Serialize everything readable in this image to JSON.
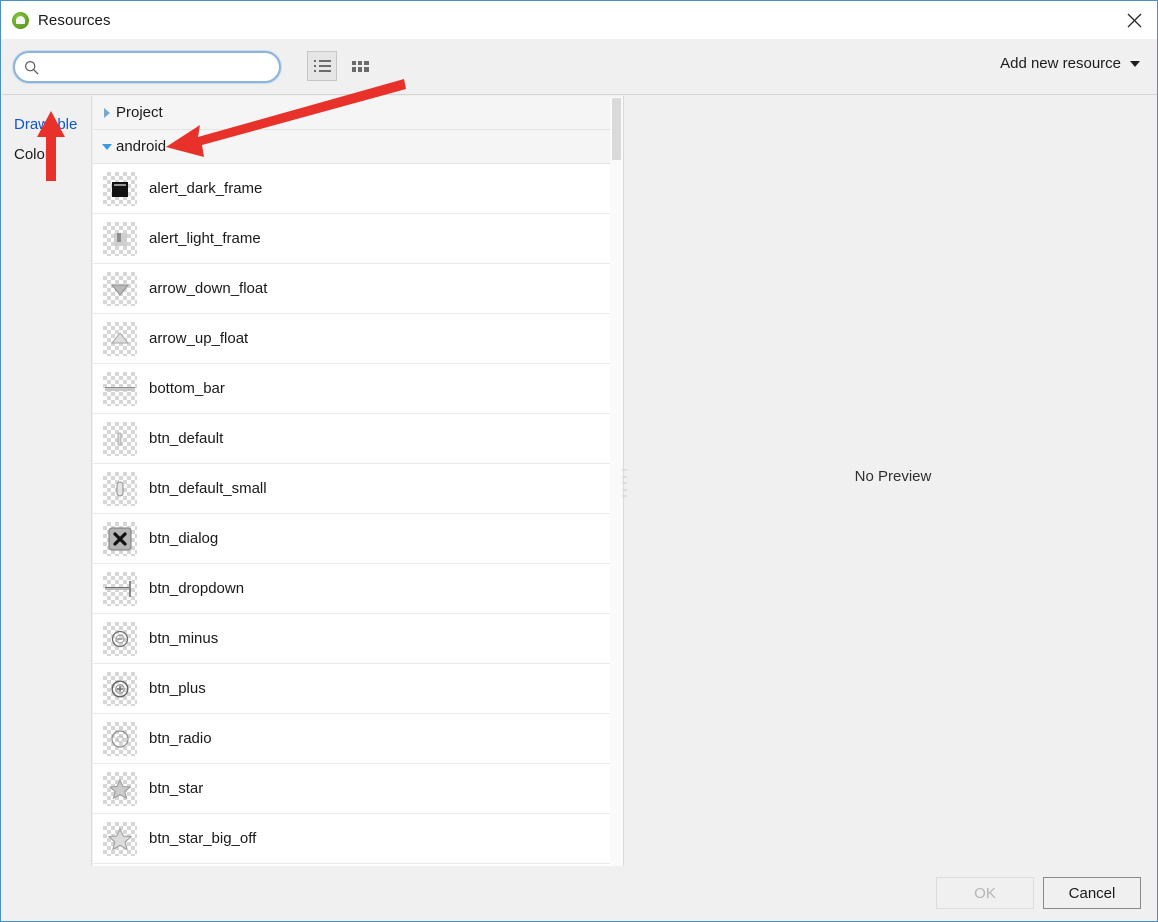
{
  "window": {
    "title": "Resources",
    "icon": "android-icon",
    "close_label": "×"
  },
  "toolbar": {
    "search": {
      "value": "",
      "placeholder": "",
      "icon": "search-icon"
    },
    "view_list_label": "list-view",
    "view_grid_label": "grid-view",
    "add_resource_label": "Add new resource"
  },
  "sidebar": {
    "items": [
      {
        "label": "Drawable",
        "active": true
      },
      {
        "label": "Color",
        "active": false
      }
    ]
  },
  "tree": {
    "groups": [
      {
        "label": "Project",
        "expanded": false
      },
      {
        "label": "android",
        "expanded": true
      }
    ]
  },
  "resources": [
    {
      "name": "alert_dark_frame",
      "glyph": "alert-dark-frame"
    },
    {
      "name": "alert_light_frame",
      "glyph": "alert-light-frame"
    },
    {
      "name": "arrow_down_float",
      "glyph": "arrow-down-float"
    },
    {
      "name": "arrow_up_float",
      "glyph": "arrow-up-float"
    },
    {
      "name": "bottom_bar",
      "glyph": "bottom-bar"
    },
    {
      "name": "btn_default",
      "glyph": "btn-default"
    },
    {
      "name": "btn_default_small",
      "glyph": "btn-default-small"
    },
    {
      "name": "btn_dialog",
      "glyph": "btn-dialog"
    },
    {
      "name": "btn_dropdown",
      "glyph": "btn-dropdown"
    },
    {
      "name": "btn_minus",
      "glyph": "btn-minus"
    },
    {
      "name": "btn_plus",
      "glyph": "btn-plus"
    },
    {
      "name": "btn_radio",
      "glyph": "btn-radio"
    },
    {
      "name": "btn_star",
      "glyph": "btn-star"
    },
    {
      "name": "btn_star_big_off",
      "glyph": "btn-star-big-off"
    }
  ],
  "preview": {
    "empty_text": "No Preview"
  },
  "footer": {
    "ok_label": "OK",
    "ok_disabled": true,
    "cancel_label": "Cancel"
  },
  "annotations": {
    "color": "#e8312a",
    "arrows": [
      {
        "name": "arrow-pointing-drawable",
        "target": "Drawable"
      },
      {
        "name": "arrow-pointing-android",
        "target": "android"
      }
    ]
  }
}
